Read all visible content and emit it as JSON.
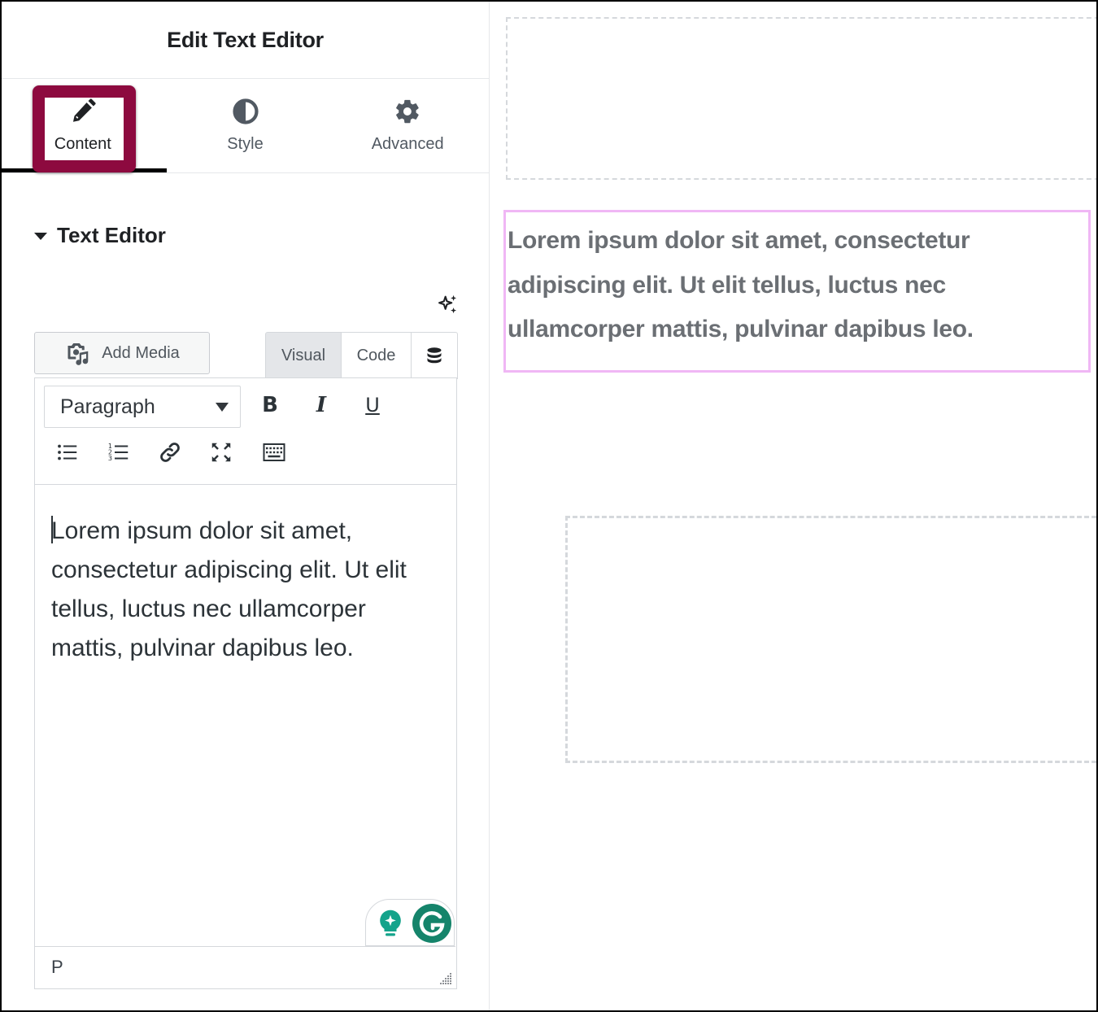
{
  "panel": {
    "title": "Edit Text Editor",
    "tabs": [
      {
        "label": "Content",
        "icon": "pencil-icon",
        "active": true
      },
      {
        "label": "Style",
        "icon": "half-circle-icon",
        "active": false
      },
      {
        "label": "Advanced",
        "icon": "gear-icon",
        "active": false
      }
    ],
    "highlight_color": "#8d0a3f"
  },
  "section": {
    "title": "Text Editor",
    "expanded": true
  },
  "editor": {
    "add_media_label": "Add Media",
    "modes": {
      "visual": "Visual",
      "code": "Code"
    },
    "active_mode": "Visual",
    "format_select": "Paragraph",
    "toolbar": {
      "bold": "B",
      "italic": "I",
      "underline": "U"
    },
    "content": "Lorem ipsum dolor sit amet, consectetur adipiscing elit. Ut elit tellus, luctus nec ullamcorper mattis, pulvinar dapibus leo.",
    "status_path": "P"
  },
  "preview": {
    "text": "Lorem ipsum dolor sit amet, consectetur adipiscing elit. Ut elit tellus, luctus nec ullamcorper mattis, pulvinar dapibus leo.",
    "text_color": "#6b6f74",
    "widget_border_color": "#f0b7f5"
  }
}
